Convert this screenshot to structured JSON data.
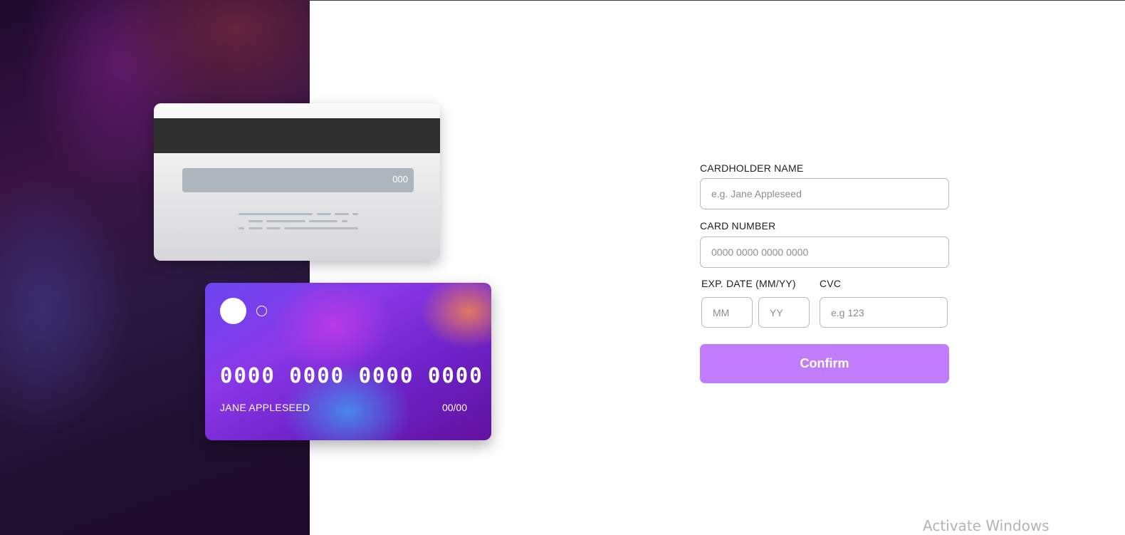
{
  "card_back": {
    "cvc": "000"
  },
  "card_front": {
    "number": "0000 0000 0000 0000",
    "name": "JANE APPLESEED",
    "expiry": "00/00"
  },
  "form": {
    "cardholder_label": "CARDHOLDER NAME",
    "cardholder_placeholder": "e.g. Jane Appleseed",
    "number_label": "CARD NUMBER",
    "number_placeholder": "0000 0000 0000 0000",
    "exp_label": "EXP. DATE (MM/YY)",
    "mm_placeholder": "MM",
    "yy_placeholder": "YY",
    "cvc_label": "CVC",
    "cvc_placeholder": "e.g 123",
    "confirm_label": "Confirm"
  },
  "os": {
    "watermark": "Activate Windows"
  },
  "colors": {
    "accent": "#c17cfc",
    "card_gradient_start": "#6a45f0",
    "card_gradient_end": "#62129e"
  }
}
